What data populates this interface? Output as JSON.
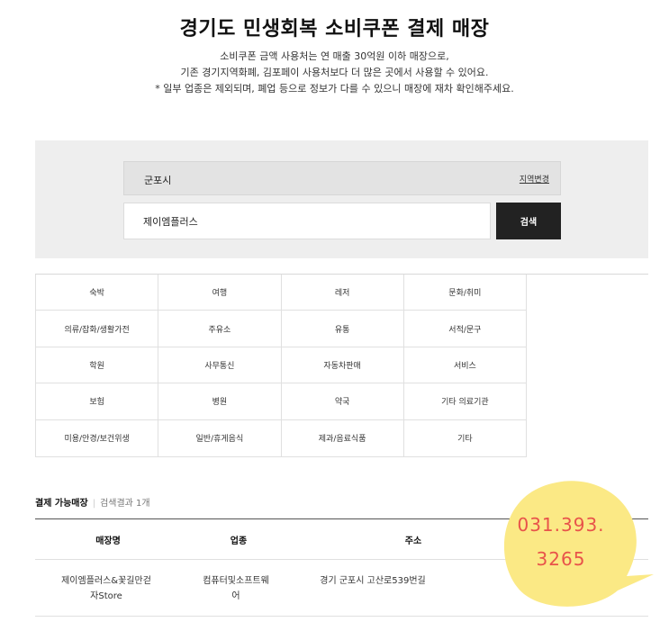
{
  "header": {
    "title": "경기도 민생회복 소비쿠폰 결제 매장",
    "subtitle_lines": [
      "소비쿠폰 금액 사용처는 연 매출 30억원 이하 매장으로,",
      "기존 경기지역화폐, 김포페이 사용처보다 더 많은 곳에서 사용할 수 있어요.",
      "* 일부 업종은 제외되며, 폐업 등으로 정보가 다를 수 있으니 매장에 재차 확인해주세요."
    ]
  },
  "search": {
    "region": "군포시",
    "region_change_label": "지역변경",
    "query": "제이엠플러스",
    "button_label": "검색"
  },
  "categories": [
    "숙박",
    "여행",
    "레저",
    "문화/취미",
    "의류/잡화/생활가전",
    "주유소",
    "유통",
    "서적/문구",
    "학원",
    "사무통신",
    "자동차판매",
    "서비스",
    "보험",
    "병원",
    "약국",
    "기타 의료기관",
    "미용/안경/보건위생",
    "일반/휴게음식",
    "제과/음료식품",
    "기타"
  ],
  "results": {
    "title": "결제 가능매장",
    "count_text": "검색결과 1개",
    "columns": [
      "매장명",
      "업종",
      "주소"
    ],
    "rows": [
      {
        "name": [
          "제이엠플러스&꽃길만걷",
          "자Store"
        ],
        "category": [
          "컴퓨터및소프트웨",
          "어"
        ],
        "address": "경기 군포시 고산로539번길"
      }
    ]
  },
  "overlay": {
    "phone_line1": "031.393.",
    "phone_line2": "3265",
    "bubble_color": "#fbe985",
    "text_color": "#e8534a",
    "cut_text": "0"
  }
}
